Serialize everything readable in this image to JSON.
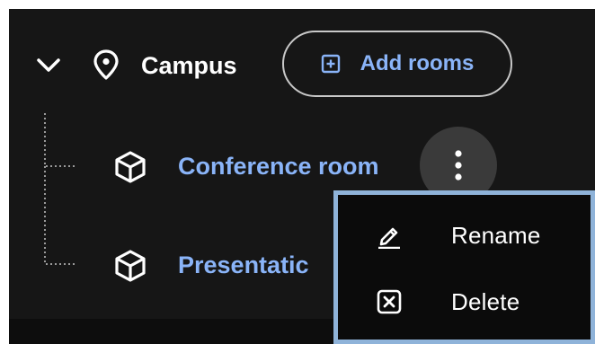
{
  "tree": {
    "root": {
      "label": "Campus",
      "add_rooms_label": "Add rooms"
    },
    "rooms": [
      {
        "label": "Conference room"
      },
      {
        "label": "Presentatic"
      }
    ]
  },
  "context_menu": {
    "items": [
      {
        "label": "Rename",
        "icon": "pencil-icon"
      },
      {
        "label": "Delete",
        "icon": "close-box-icon"
      }
    ]
  },
  "colors": {
    "background": "#161616",
    "link_blue": "#8ab4f8",
    "menu_border": "#8fb3d9",
    "more_button_bg": "#3a3a3a"
  }
}
